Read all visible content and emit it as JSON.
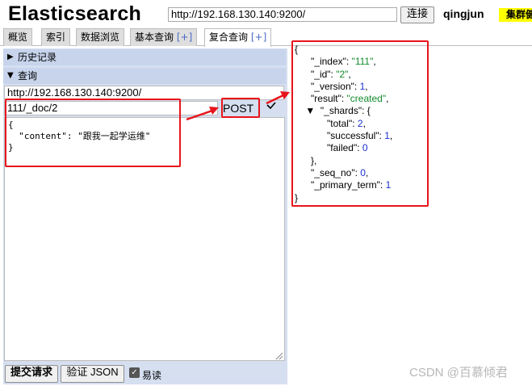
{
  "header": {
    "app_title": "Elasticsearch",
    "server_url": "http://192.168.130.140:9200/",
    "connect_label": "连接",
    "cluster_name": "qingjun",
    "cluster_health": "集群健康值: green"
  },
  "tabs": [
    {
      "label": "概览"
    },
    {
      "label": "索引"
    },
    {
      "label": "数据浏览"
    },
    {
      "label": "基本查询",
      "plus": "[+]"
    },
    {
      "label": "复合查询",
      "plus": "[+]",
      "active": true
    }
  ],
  "query_panel": {
    "history_label": "历史记录",
    "query_label": "查询",
    "base_url": "http://192.168.130.140:9200/",
    "path": "111/_doc/2",
    "method": "POST",
    "body_lines": [
      "{",
      "  \"content\": \"跟我一起学运维\"",
      "}"
    ],
    "submit_label": "提交请求",
    "validate_label": "验证 JSON",
    "pretty_label": "易读",
    "pretty_checked": true
  },
  "response": {
    "open": "{",
    "index_key": "\"_index\": ",
    "index_val": "\"111\"",
    "id_key": "\"_id\": ",
    "id_val": "\"2\"",
    "version_key": "\"_version\": ",
    "version_val": "1",
    "result_key": "\"result\": ",
    "result_val": "\"created\"",
    "shards_key": "\"_shards\": {",
    "total_key": "\"total\": ",
    "total_val": "2",
    "successful_key": "\"successful\": ",
    "successful_val": "1",
    "failed_key": "\"failed\": ",
    "failed_val": "0",
    "shards_close": "},",
    "seq_key": "\"_seq_no\": ",
    "seq_val": "0",
    "primary_key": "\"_primary_term\": ",
    "primary_val": "1",
    "close": "}"
  },
  "watermark": "CSDN @百慕倾君",
  "colors": {
    "annotation_red": "#e8141b",
    "health_yellow": "#ffff00",
    "string_green": "#138a2b",
    "number_blue": "#1a2fd0",
    "panel_blue": "#d5dff0"
  }
}
